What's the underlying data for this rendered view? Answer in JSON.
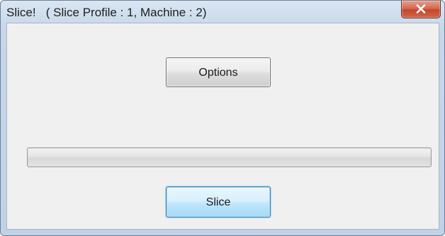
{
  "window": {
    "title": "Slice!   ( Slice Profile : 1, Machine : 2)",
    "close_icon": "close-icon"
  },
  "buttons": {
    "options_label": "Options",
    "slice_label": "Slice"
  },
  "progress": {
    "value_percent": 0
  },
  "colors": {
    "close_button": "#c7482c",
    "default_button_border": "#3c7fb1",
    "client_background": "#f0f0f0"
  }
}
